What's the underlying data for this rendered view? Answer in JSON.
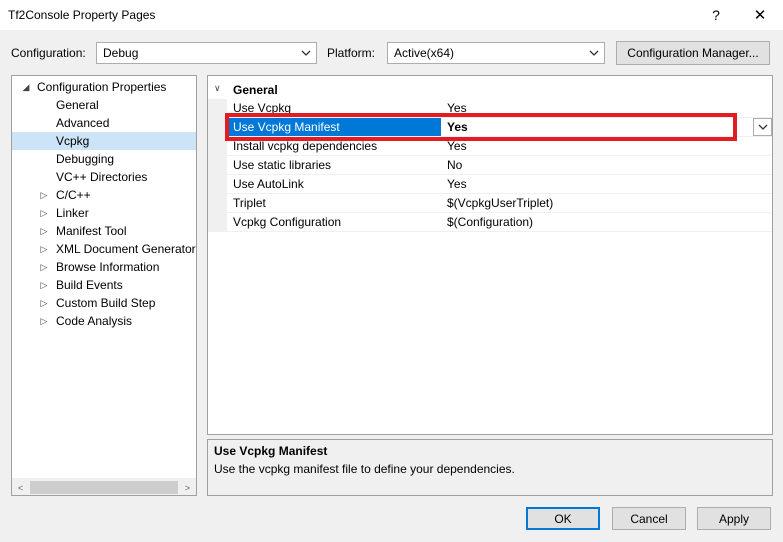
{
  "window": {
    "title": "Tf2Console Property Pages",
    "help": "?",
    "close": "✕"
  },
  "config": {
    "label": "Configuration:",
    "value": "Debug"
  },
  "platform": {
    "label": "Platform:",
    "value": "Active(x64)"
  },
  "config_manager_label": "Configuration Manager...",
  "tree": {
    "root": "Configuration Properties",
    "items": [
      {
        "label": "General",
        "expandable": false
      },
      {
        "label": "Advanced",
        "expandable": false
      },
      {
        "label": "Vcpkg",
        "expandable": false,
        "selected": true
      },
      {
        "label": "Debugging",
        "expandable": false
      },
      {
        "label": "VC++ Directories",
        "expandable": false
      },
      {
        "label": "C/C++",
        "expandable": true
      },
      {
        "label": "Linker",
        "expandable": true
      },
      {
        "label": "Manifest Tool",
        "expandable": true
      },
      {
        "label": "XML Document Generator",
        "expandable": true
      },
      {
        "label": "Browse Information",
        "expandable": true
      },
      {
        "label": "Build Events",
        "expandable": true
      },
      {
        "label": "Custom Build Step",
        "expandable": true
      },
      {
        "label": "Code Analysis",
        "expandable": true
      }
    ]
  },
  "grid": {
    "section": "General",
    "rows": [
      {
        "name": "Use Vcpkg",
        "value": "Yes"
      },
      {
        "name": "Use Vcpkg Manifest",
        "value": "Yes",
        "selected": true
      },
      {
        "name": "Install vcpkg dependencies",
        "value": "Yes"
      },
      {
        "name": "Use static libraries",
        "value": "No"
      },
      {
        "name": "Use AutoLink",
        "value": "Yes"
      },
      {
        "name": "Triplet",
        "value": "$(VcpkgUserTriplet)"
      },
      {
        "name": "Vcpkg Configuration",
        "value": "$(Configuration)"
      }
    ]
  },
  "description": {
    "title": "Use Vcpkg Manifest",
    "text": "Use the vcpkg manifest file to define your dependencies."
  },
  "buttons": {
    "ok": "OK",
    "cancel": "Cancel",
    "apply": "Apply"
  },
  "colors": {
    "accent": "#0078d7",
    "highlight": "#e31b23",
    "tree_selected": "#cce4f7"
  }
}
